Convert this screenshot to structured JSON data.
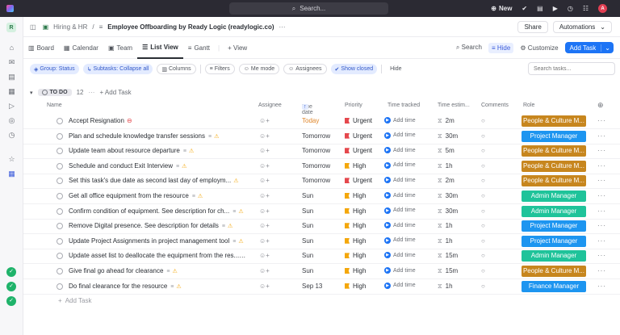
{
  "topbar": {
    "search_label": "Search...",
    "new_label": "New",
    "avatar_initial": "A"
  },
  "sidebar": {
    "workspace_initial": "R"
  },
  "breadcrumb": {
    "space": "Hiring & HR",
    "separator": "/",
    "list": "Employee Offboarding by Ready Logic (readylogic.co)",
    "more": "···"
  },
  "header_actions": {
    "share": "Share",
    "automations": "Automations"
  },
  "views": {
    "tabs": [
      {
        "label": "Board",
        "icon": "board-icon"
      },
      {
        "label": "Calendar",
        "icon": "calendar-icon"
      },
      {
        "label": "Team",
        "icon": "team-icon"
      },
      {
        "label": "List View",
        "icon": "list-icon",
        "active": true
      },
      {
        "label": "Gantt",
        "icon": "gantt-icon"
      }
    ],
    "add_view": "+ View",
    "search": "Search",
    "hide": "Hide",
    "customize": "Customize",
    "add_task": "Add Task"
  },
  "filters": {
    "group": "Group: Status",
    "subtasks": "Subtasks: Collapse all",
    "columns": "Columns",
    "filters": "Filters",
    "me_mode": "Me mode",
    "assignees": "Assignees",
    "show_closed": "Show closed",
    "hide": "Hide",
    "search_placeholder": "Search tasks..."
  },
  "group": {
    "status": "TO DO",
    "count": "12",
    "add_task": "+ Add Task"
  },
  "columns": {
    "name": "Name",
    "assignee": "Assignee",
    "due": "Due date",
    "priority": "Priority",
    "tracked": "Time tracked",
    "estimate": "Time estim...",
    "comments": "Comments",
    "role": "Role"
  },
  "colors": {
    "urgent_flag": "#e5484d",
    "high_flag": "#f4a70b",
    "people_culture": "#c7861e",
    "project_manager": "#1d95f0",
    "admin_manager": "#1fc39a",
    "finance_manager": "#1d95f0"
  },
  "tasks": [
    {
      "name": "Accept Resignation",
      "icons": [
        "stop"
      ],
      "due": "Today",
      "priority": "Urgent",
      "tracked": "Add time",
      "estimate": "2m",
      "role": "People & Culture M...",
      "role_color": "#c7861e"
    },
    {
      "name": "Plan and schedule knowledge transfer sessions",
      "icons": [
        "desc",
        "warn"
      ],
      "due": "Tomorrow",
      "priority": "Urgent",
      "tracked": "Add time",
      "estimate": "30m",
      "role": "Project Manager",
      "role_color": "#1d95f0"
    },
    {
      "name": "Update team about resource departure",
      "icons": [
        "desc",
        "warn"
      ],
      "due": "Tomorrow",
      "priority": "Urgent",
      "tracked": "Add time",
      "estimate": "5m",
      "role": "People & Culture M...",
      "role_color": "#c7861e"
    },
    {
      "name": "Schedule and conduct Exit Interview",
      "icons": [
        "desc",
        "warn"
      ],
      "due": "Tomorrow",
      "priority": "High",
      "tracked": "Add time",
      "estimate": "1h",
      "role": "People & Culture M...",
      "role_color": "#c7861e"
    },
    {
      "name": "Set this task's due date as second last day of employm...",
      "icons": [
        "warn"
      ],
      "due": "Tomorrow",
      "priority": "Urgent",
      "tracked": "Add time",
      "estimate": "2m",
      "role": "People & Culture M...",
      "role_color": "#c7861e"
    },
    {
      "name": "Get all office equipment from the resource",
      "icons": [
        "desc",
        "warn"
      ],
      "due": "Sun",
      "priority": "High",
      "tracked": "Add time",
      "estimate": "30m",
      "role": "Admin Manager",
      "role_color": "#1fc39a"
    },
    {
      "name": "Confirm condition of equipment. See description for ch...",
      "icons": [
        "desc",
        "warn"
      ],
      "due": "Sun",
      "priority": "High",
      "tracked": "Add time",
      "estimate": "30m",
      "role": "Admin Manager",
      "role_color": "#1fc39a"
    },
    {
      "name": "Remove Digital presence. See description for details",
      "icons": [
        "desc",
        "warn"
      ],
      "due": "Sun",
      "priority": "High",
      "tracked": "Add time",
      "estimate": "1h",
      "role": "Project Manager",
      "role_color": "#1d95f0"
    },
    {
      "name": "Update Project Assignments in project management tool",
      "icons": [
        "desc",
        "warn"
      ],
      "due": "Sun",
      "priority": "High",
      "tracked": "Add time",
      "estimate": "1h",
      "role": "Project Manager",
      "role_color": "#1d95f0"
    },
    {
      "name": "Update asset list to deallocate the equipment from the res...",
      "icons": [
        "desc",
        "warn"
      ],
      "due": "Sun",
      "priority": "High",
      "tracked": "Add time",
      "estimate": "15m",
      "role": "Admin Manager",
      "role_color": "#1fc39a"
    },
    {
      "name": "Give final go ahead for clearance",
      "icons": [
        "desc",
        "warn"
      ],
      "due": "Sun",
      "priority": "High",
      "tracked": "Add time",
      "estimate": "15m",
      "role": "People & Culture M...",
      "role_color": "#c7861e"
    },
    {
      "name": "Do final clearance for the resource",
      "icons": [
        "desc",
        "warn"
      ],
      "due": "Sep 13",
      "priority": "High",
      "tracked": "Add time",
      "estimate": "1h",
      "role": "Finance Manager",
      "role_color": "#1d95f0"
    }
  ],
  "add_task_row": "Add Task"
}
